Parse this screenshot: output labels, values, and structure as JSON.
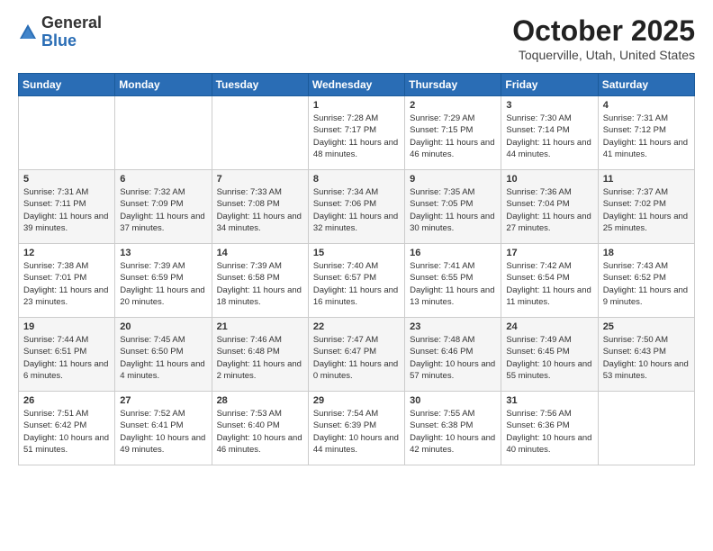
{
  "header": {
    "logo_general": "General",
    "logo_blue": "Blue",
    "month_title": "October 2025",
    "location": "Toquerville, Utah, United States"
  },
  "weekdays": [
    "Sunday",
    "Monday",
    "Tuesday",
    "Wednesday",
    "Thursday",
    "Friday",
    "Saturday"
  ],
  "weeks": [
    [
      {
        "day": "",
        "info": ""
      },
      {
        "day": "",
        "info": ""
      },
      {
        "day": "",
        "info": ""
      },
      {
        "day": "1",
        "info": "Sunrise: 7:28 AM\nSunset: 7:17 PM\nDaylight: 11 hours\nand 48 minutes."
      },
      {
        "day": "2",
        "info": "Sunrise: 7:29 AM\nSunset: 7:15 PM\nDaylight: 11 hours\nand 46 minutes."
      },
      {
        "day": "3",
        "info": "Sunrise: 7:30 AM\nSunset: 7:14 PM\nDaylight: 11 hours\nand 44 minutes."
      },
      {
        "day": "4",
        "info": "Sunrise: 7:31 AM\nSunset: 7:12 PM\nDaylight: 11 hours\nand 41 minutes."
      }
    ],
    [
      {
        "day": "5",
        "info": "Sunrise: 7:31 AM\nSunset: 7:11 PM\nDaylight: 11 hours\nand 39 minutes."
      },
      {
        "day": "6",
        "info": "Sunrise: 7:32 AM\nSunset: 7:09 PM\nDaylight: 11 hours\nand 37 minutes."
      },
      {
        "day": "7",
        "info": "Sunrise: 7:33 AM\nSunset: 7:08 PM\nDaylight: 11 hours\nand 34 minutes."
      },
      {
        "day": "8",
        "info": "Sunrise: 7:34 AM\nSunset: 7:06 PM\nDaylight: 11 hours\nand 32 minutes."
      },
      {
        "day": "9",
        "info": "Sunrise: 7:35 AM\nSunset: 7:05 PM\nDaylight: 11 hours\nand 30 minutes."
      },
      {
        "day": "10",
        "info": "Sunrise: 7:36 AM\nSunset: 7:04 PM\nDaylight: 11 hours\nand 27 minutes."
      },
      {
        "day": "11",
        "info": "Sunrise: 7:37 AM\nSunset: 7:02 PM\nDaylight: 11 hours\nand 25 minutes."
      }
    ],
    [
      {
        "day": "12",
        "info": "Sunrise: 7:38 AM\nSunset: 7:01 PM\nDaylight: 11 hours\nand 23 minutes."
      },
      {
        "day": "13",
        "info": "Sunrise: 7:39 AM\nSunset: 6:59 PM\nDaylight: 11 hours\nand 20 minutes."
      },
      {
        "day": "14",
        "info": "Sunrise: 7:39 AM\nSunset: 6:58 PM\nDaylight: 11 hours\nand 18 minutes."
      },
      {
        "day": "15",
        "info": "Sunrise: 7:40 AM\nSunset: 6:57 PM\nDaylight: 11 hours\nand 16 minutes."
      },
      {
        "day": "16",
        "info": "Sunrise: 7:41 AM\nSunset: 6:55 PM\nDaylight: 11 hours\nand 13 minutes."
      },
      {
        "day": "17",
        "info": "Sunrise: 7:42 AM\nSunset: 6:54 PM\nDaylight: 11 hours\nand 11 minutes."
      },
      {
        "day": "18",
        "info": "Sunrise: 7:43 AM\nSunset: 6:52 PM\nDaylight: 11 hours\nand 9 minutes."
      }
    ],
    [
      {
        "day": "19",
        "info": "Sunrise: 7:44 AM\nSunset: 6:51 PM\nDaylight: 11 hours\nand 6 minutes."
      },
      {
        "day": "20",
        "info": "Sunrise: 7:45 AM\nSunset: 6:50 PM\nDaylight: 11 hours\nand 4 minutes."
      },
      {
        "day": "21",
        "info": "Sunrise: 7:46 AM\nSunset: 6:48 PM\nDaylight: 11 hours\nand 2 minutes."
      },
      {
        "day": "22",
        "info": "Sunrise: 7:47 AM\nSunset: 6:47 PM\nDaylight: 11 hours\nand 0 minutes."
      },
      {
        "day": "23",
        "info": "Sunrise: 7:48 AM\nSunset: 6:46 PM\nDaylight: 10 hours\nand 57 minutes."
      },
      {
        "day": "24",
        "info": "Sunrise: 7:49 AM\nSunset: 6:45 PM\nDaylight: 10 hours\nand 55 minutes."
      },
      {
        "day": "25",
        "info": "Sunrise: 7:50 AM\nSunset: 6:43 PM\nDaylight: 10 hours\nand 53 minutes."
      }
    ],
    [
      {
        "day": "26",
        "info": "Sunrise: 7:51 AM\nSunset: 6:42 PM\nDaylight: 10 hours\nand 51 minutes."
      },
      {
        "day": "27",
        "info": "Sunrise: 7:52 AM\nSunset: 6:41 PM\nDaylight: 10 hours\nand 49 minutes."
      },
      {
        "day": "28",
        "info": "Sunrise: 7:53 AM\nSunset: 6:40 PM\nDaylight: 10 hours\nand 46 minutes."
      },
      {
        "day": "29",
        "info": "Sunrise: 7:54 AM\nSunset: 6:39 PM\nDaylight: 10 hours\nand 44 minutes."
      },
      {
        "day": "30",
        "info": "Sunrise: 7:55 AM\nSunset: 6:38 PM\nDaylight: 10 hours\nand 42 minutes."
      },
      {
        "day": "31",
        "info": "Sunrise: 7:56 AM\nSunset: 6:36 PM\nDaylight: 10 hours\nand 40 minutes."
      },
      {
        "day": "",
        "info": ""
      }
    ]
  ]
}
